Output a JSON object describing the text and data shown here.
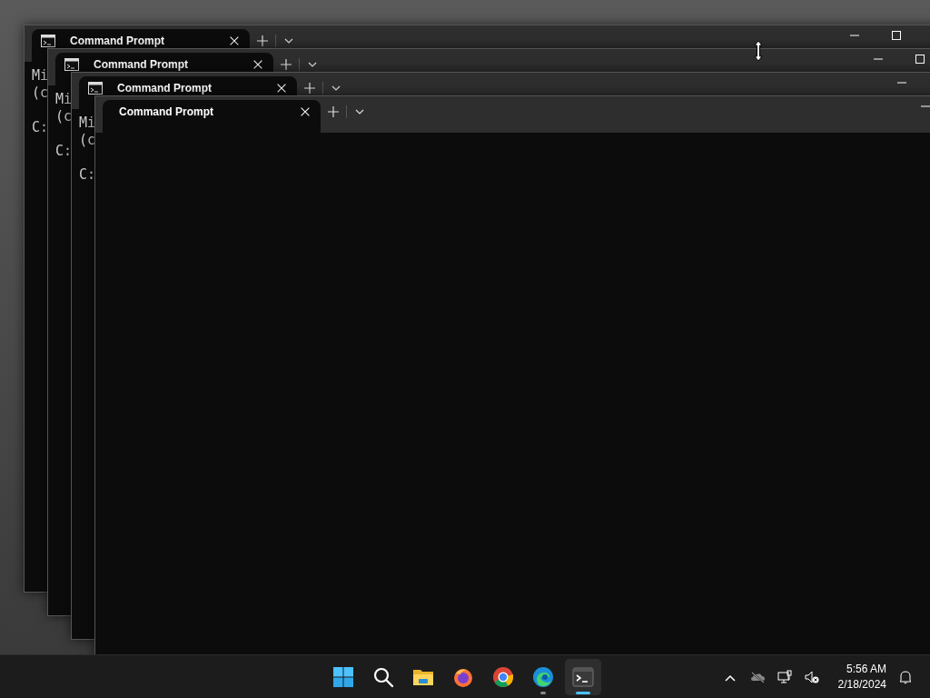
{
  "windows": [
    {
      "tab": {
        "title": "Command Prompt",
        "show_icon": true
      },
      "paragraphs": [
        [
          "Mi",
          "(c"
        ],
        [
          "C:"
        ]
      ]
    },
    {
      "tab": {
        "title": "Command Prompt",
        "show_icon": true
      },
      "paragraphs": [
        [
          "Mi",
          "(c"
        ],
        [
          "C:"
        ]
      ]
    },
    {
      "tab": {
        "title": "Command Prompt",
        "show_icon": true
      },
      "paragraphs": [
        [
          "Mi",
          "(c"
        ],
        [
          "C:"
        ]
      ]
    },
    {
      "tab": {
        "title": "Command Prompt",
        "show_icon": false
      }
    }
  ],
  "taskbar": {
    "apps": [
      {
        "kind": "start",
        "running": false,
        "selected": false
      },
      {
        "kind": "search",
        "running": false,
        "selected": false
      },
      {
        "kind": "folder",
        "running": false,
        "selected": false
      },
      {
        "kind": "firefox",
        "running": false,
        "selected": false
      },
      {
        "kind": "chrome",
        "running": false,
        "selected": false
      },
      {
        "kind": "edge",
        "running": true,
        "selected": false
      },
      {
        "kind": "terminal",
        "running": true,
        "selected": true
      }
    ],
    "tray": [
      {
        "kind": "chevron"
      },
      {
        "kind": "cloud-off"
      },
      {
        "kind": "network"
      },
      {
        "kind": "volume-muted"
      }
    ],
    "time": "5:56 AM",
    "date": "2/18/2024"
  }
}
